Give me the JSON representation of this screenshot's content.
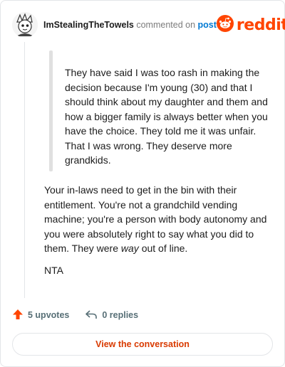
{
  "header": {
    "username": "ImStealingTheTowels",
    "commented_on": "commented on",
    "post_link": "post",
    "brand": "reddit"
  },
  "comment": {
    "quote": "They have said I was too rash in making the decision because I'm young (30) and that I should think about my daughter and them and how a bigger family is always better when you have the choice. They told me it was unfair. That I was wrong. They deserve more grandkids.",
    "body_before_em": "Your in-laws need to get in the bin with their entitlement. You're not a grandchild vending machine; you're a person with body autonomy and you were absolutely right to say what you did to them. They were ",
    "body_em": "way",
    "body_after_em": " out of line.",
    "verdict": "NTA"
  },
  "actions": {
    "upvotes": "5 upvotes",
    "replies": "0 replies"
  },
  "view_button": "View the conversation",
  "colors": {
    "accent": "#ff4500",
    "link": "#0079d3",
    "button_text": "#d93a00",
    "muted": "#576f76"
  },
  "icons": {
    "upvote": "upvote-arrow-icon",
    "reply": "reply-arrow-icon",
    "brand": "reddit-snoo-icon"
  }
}
